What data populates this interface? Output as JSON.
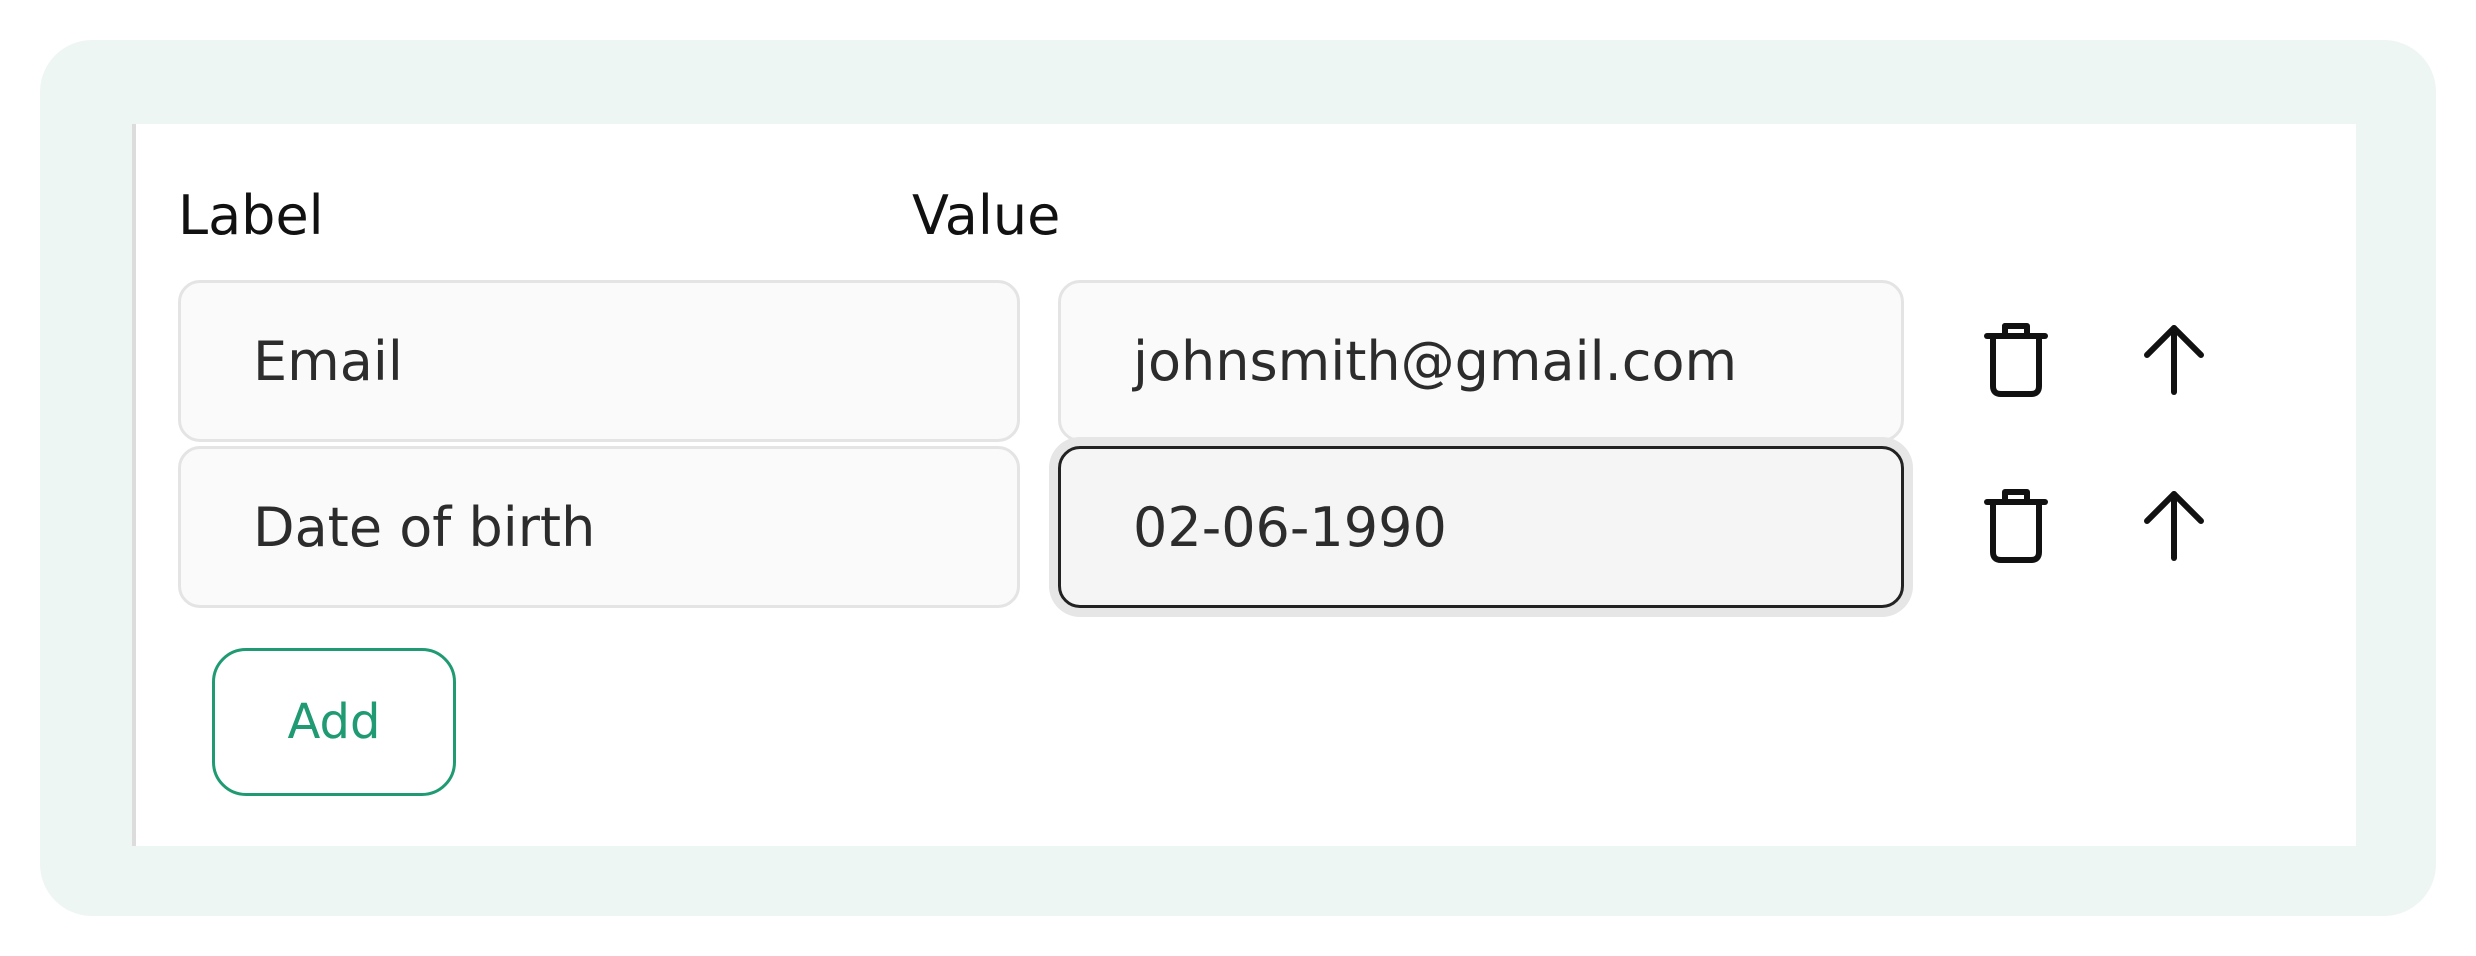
{
  "headers": {
    "label": "Label",
    "value": "Value"
  },
  "rows": [
    {
      "label": "Email",
      "value": "johnsmith@gmail.com",
      "focused": false
    },
    {
      "label": "Date of birth",
      "value": "02-06-1990",
      "focused": true
    }
  ],
  "actions": {
    "add_label": "Add",
    "delete_icon": "trash-icon",
    "move_up_icon": "arrow-up-icon"
  },
  "colors": {
    "accent": "#1f9a72",
    "frame_background": "#edf6f3",
    "focused_border": "#222222"
  }
}
